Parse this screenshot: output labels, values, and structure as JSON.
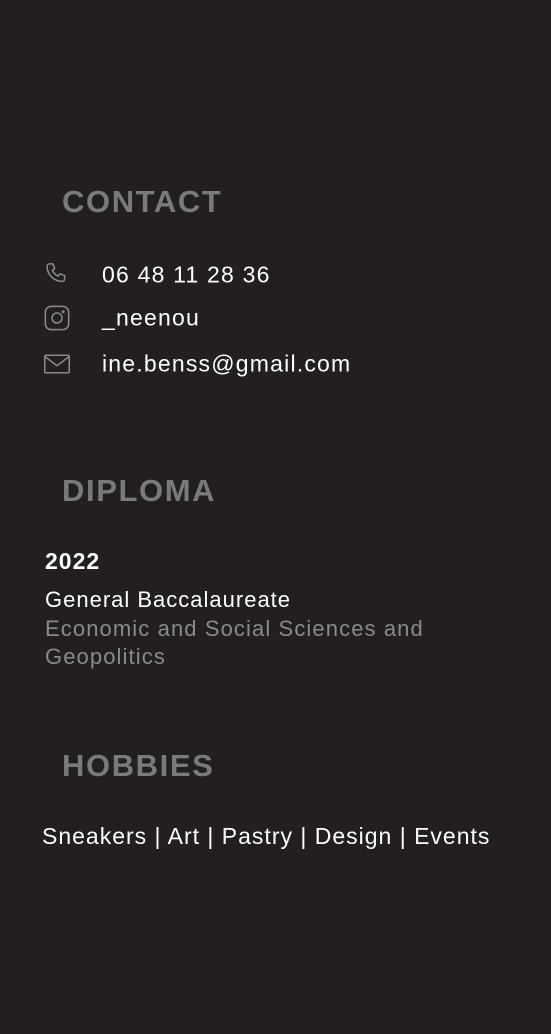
{
  "contact": {
    "heading": "CONTACT",
    "items": [
      {
        "icon": "phone-icon",
        "text": "06 48 11 28 36"
      },
      {
        "icon": "instagram-icon",
        "text": "_neenou"
      },
      {
        "icon": "mail-icon",
        "text": "ine.benss@gmail.com"
      }
    ]
  },
  "diploma": {
    "heading": "DIPLOMA",
    "year": "2022",
    "title": "General Baccalaureate",
    "subtitle": "Economic and Social Sciences and Geopolitics"
  },
  "hobbies": {
    "heading": "HOBBIES",
    "text": "Sneakers | Art | Pastry | Design | Events"
  },
  "colors": {
    "background": "#231f20",
    "heading": "#7a7a7a",
    "text": "#ffffff",
    "muted": "#8a8a8a"
  }
}
